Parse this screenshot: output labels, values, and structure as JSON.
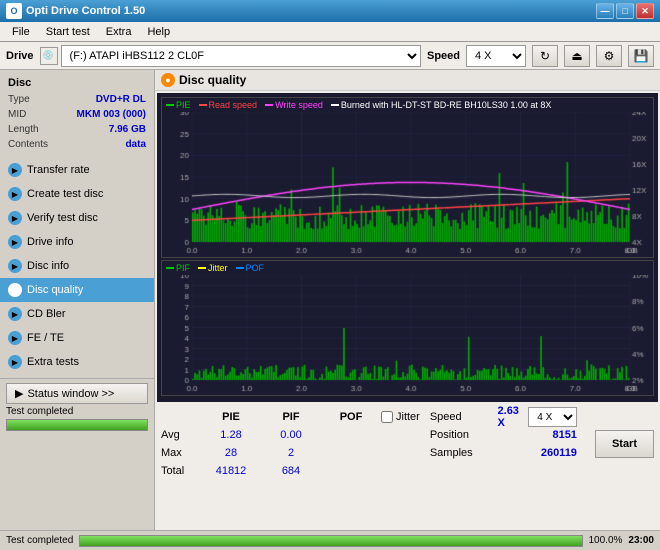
{
  "app": {
    "title": "Opti Drive Control 1.50",
    "icon": "O"
  },
  "titlebar_buttons": [
    "—",
    "□",
    "✕"
  ],
  "menu": {
    "items": [
      "File",
      "Start test",
      "Extra",
      "Help"
    ]
  },
  "drivebar": {
    "label": "Drive",
    "drive_value": "(F:)  ATAPI iHBS112  2 CL0F",
    "speed_label": "Speed",
    "speed_value": "4 X"
  },
  "disc": {
    "header": "Disc",
    "type_label": "Type",
    "type_value": "DVD+R DL",
    "mid_label": "MID",
    "mid_value": "MKM 003 (000)",
    "length_label": "Length",
    "length_value": "7.96 GB",
    "contents_label": "Contents",
    "contents_value": "data"
  },
  "sidebar_nav": [
    {
      "id": "transfer-rate",
      "label": "Transfer rate",
      "active": false
    },
    {
      "id": "create-test-disc",
      "label": "Create test disc",
      "active": false
    },
    {
      "id": "verify-test-disc",
      "label": "Verify test disc",
      "active": false
    },
    {
      "id": "drive-info",
      "label": "Drive info",
      "active": false
    },
    {
      "id": "disc-info",
      "label": "Disc info",
      "active": false
    },
    {
      "id": "disc-quality",
      "label": "Disc quality",
      "active": true
    },
    {
      "id": "cd-bler",
      "label": "CD Bler",
      "active": false
    },
    {
      "id": "fe-te",
      "label": "FE / TE",
      "active": false
    },
    {
      "id": "extra-tests",
      "label": "Extra tests",
      "active": false
    }
  ],
  "status_window_btn": "Status window >>",
  "test_completed_label": "Test completed",
  "progress_percent": "100.0%",
  "disc_quality": {
    "title": "Disc quality",
    "legend": [
      {
        "label": "PIE",
        "color": "#00cc00"
      },
      {
        "label": "Read speed",
        "color": "#ff0000"
      },
      {
        "label": "Write speed",
        "color": "#ff00ff"
      },
      {
        "label": "Burned with HL-DT-ST BD-RE  BH10LS30 1.00 at 8X",
        "color": "#ffffff"
      }
    ],
    "lower_legend": [
      {
        "label": "PIF",
        "color": "#00cc00"
      },
      {
        "label": "Jitter",
        "color": "#ffff00"
      },
      {
        "label": "POF",
        "color": "#0088ff"
      }
    ]
  },
  "stats": {
    "columns": [
      "PIE",
      "PIF",
      "POF"
    ],
    "jitter_label": "Jitter",
    "rows": [
      {
        "label": "Avg",
        "pie": "1.28",
        "pif": "0.00",
        "pof": ""
      },
      {
        "label": "Max",
        "pie": "28",
        "pif": "2",
        "pof": ""
      },
      {
        "label": "Total",
        "pie": "41812",
        "pif": "684",
        "pof": ""
      }
    ],
    "speed_label": "Speed",
    "speed_value": "2.63 X",
    "speed_select": "4 X",
    "position_label": "Position",
    "position_value": "8151",
    "samples_label": "Samples",
    "samples_value": "260119"
  },
  "start_button": "Start",
  "bottom": {
    "test_completed": "Test completed",
    "progress": "100.0%",
    "time": "23:00"
  }
}
